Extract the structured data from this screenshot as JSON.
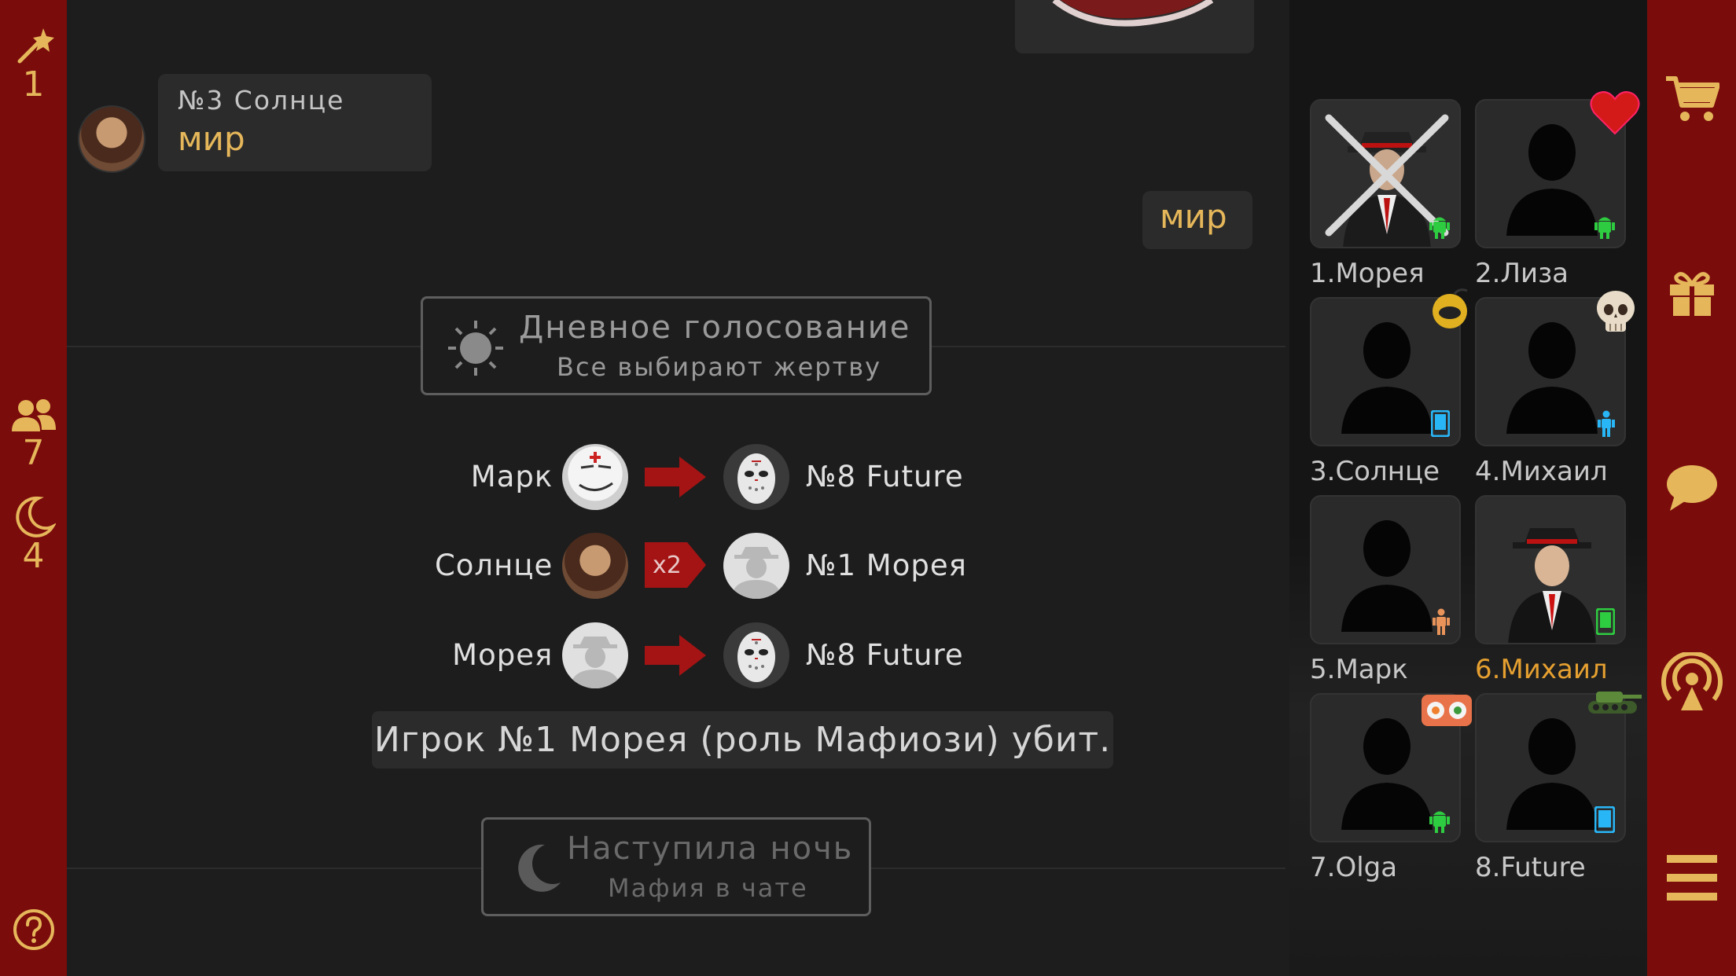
{
  "left_rail": {
    "wand_count": "1",
    "players_count": "7",
    "night_count": "4"
  },
  "chat": {
    "incoming_message": {
      "author": "№3 Солнце",
      "text": "мир"
    },
    "outgoing_message": {
      "text": "мир"
    },
    "day_event": {
      "title": "Дневное голосование",
      "subtitle": "Все выбирают жертву"
    },
    "votes": [
      {
        "from": "Марк №5",
        "multiplier": "",
        "to": "№8 Future"
      },
      {
        "from": "Солнце №3",
        "multiplier": "x2",
        "to": "№1 Морея"
      },
      {
        "from": "Морея №1",
        "multiplier": "",
        "to": "№8 Future"
      }
    ],
    "result": "Игрок №1 Морея (роль Мафиози) убит.",
    "night_event": {
      "title": "Наступила ночь",
      "subtitle": "Мафия в чате"
    }
  },
  "players": [
    {
      "label": "1.Морея",
      "status": "dead",
      "device": "android",
      "device_color": "#2ecc40",
      "badge": ""
    },
    {
      "label": "2.Лиза",
      "status": "alive",
      "device": "android",
      "device_color": "#2ecc40",
      "badge": "heart-icon"
    },
    {
      "label": "3.Солнце",
      "status": "alive",
      "device": "phone",
      "device_color": "#29b6f6",
      "badge": "bomb-icon"
    },
    {
      "label": "4.Михаил",
      "status": "alive",
      "device": "person",
      "device_color": "#29b6f6",
      "badge": "skull-icon"
    },
    {
      "label": "5.Марк",
      "status": "alive",
      "device": "person",
      "device_color": "#e8935a",
      "badge": ""
    },
    {
      "label": "6.Михаил",
      "status": "me",
      "device": "phone",
      "device_color": "#2ecc40",
      "badge": ""
    },
    {
      "label": "7.Olga",
      "status": "alive",
      "device": "android",
      "device_color": "#2ecc40",
      "badge": "sushi-icon"
    },
    {
      "label": "8.Future",
      "status": "alive",
      "device": "tablet",
      "device_color": "#29b6f6",
      "badge": "tank-icon"
    }
  ],
  "colors": {
    "rail": "#7a0c0c",
    "accent": "#e6b75a",
    "me": "#e6a030",
    "arrow": "#a51414"
  }
}
